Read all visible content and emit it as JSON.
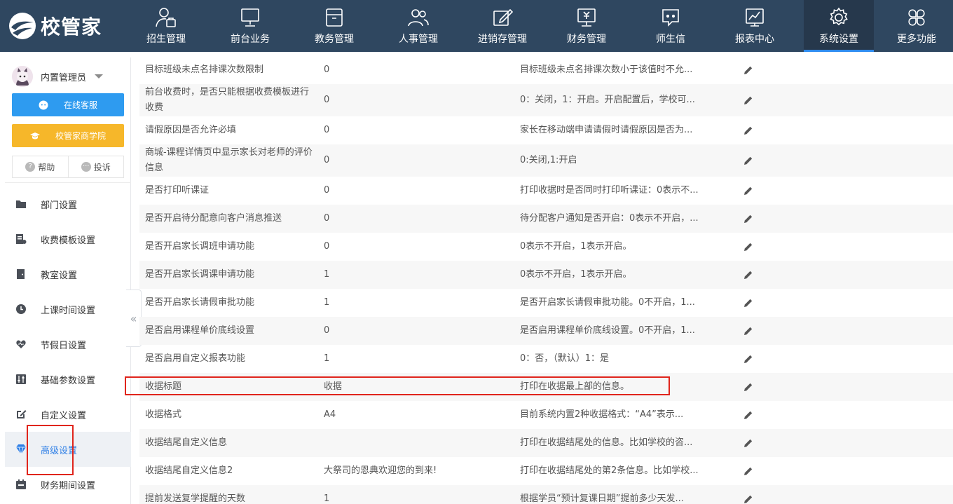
{
  "app": {
    "logo_text": "校管家"
  },
  "nav": [
    {
      "label": "招生管理",
      "icon": "user-case-icon"
    },
    {
      "label": "前台业务",
      "icon": "monitor-icon"
    },
    {
      "label": "教务管理",
      "icon": "archive-box-icon"
    },
    {
      "label": "人事管理",
      "icon": "users-icon"
    },
    {
      "label": "进销存管理",
      "icon": "edit-box-icon"
    },
    {
      "label": "财务管理",
      "icon": "finance-screen-icon"
    },
    {
      "label": "师生信",
      "icon": "chat-bubble-icon"
    },
    {
      "label": "报表中心",
      "icon": "report-chart-icon"
    },
    {
      "label": "系统设置",
      "icon": "gear-icon",
      "active": true
    },
    {
      "label": "更多功能",
      "icon": "grid-clover-icon"
    }
  ],
  "sidebar": {
    "user_name": "内置管理员",
    "service_button": "在线客服",
    "academy_button": "校管家商学院",
    "help_label": "帮助",
    "complain_label": "投诉",
    "items": [
      {
        "label": "部门设置",
        "icon": "folder-icon"
      },
      {
        "label": "收费模板设置",
        "icon": "fee-template-icon"
      },
      {
        "label": "教室设置",
        "icon": "door-icon"
      },
      {
        "label": "上课时间设置",
        "icon": "clock-icon"
      },
      {
        "label": "节假日设置",
        "icon": "heart-icon"
      },
      {
        "label": "基础参数设置",
        "icon": "sliders-icon"
      },
      {
        "label": "自定义设置",
        "icon": "pencil-box-icon"
      },
      {
        "label": "高级设置",
        "icon": "diamond-icon",
        "active": true
      },
      {
        "label": "财务期间设置",
        "icon": "calendar-icon"
      }
    ],
    "collapse_glyph": "«"
  },
  "settings": [
    {
      "name": "目标班级未点名排课次数限制",
      "value": "0",
      "desc": "目标班级未点名排课次数小于该值时不允..."
    },
    {
      "name": "前台收费时，是否只能根据收费模板进行收费",
      "value": "0",
      "desc": "0：关闭，1：开启。开启配置后，学校可..."
    },
    {
      "name": "请假原因是否允许必填",
      "value": "0",
      "desc": "家长在移动端申请请假时请假原因是否为..."
    },
    {
      "name": "商城-课程详情页中显示家长对老师的评价信息",
      "value": "0",
      "desc": "0:关闭,1:开启"
    },
    {
      "name": "是否打印听课证",
      "value": "0",
      "desc": "打印收据时是否同时打印听课证：0表示不..."
    },
    {
      "name": "是否开启待分配意向客户消息推送",
      "value": "0",
      "desc": "待分配客户通知是否开启：0表示不开启，..."
    },
    {
      "name": "是否开启家长调班申请功能",
      "value": "0",
      "desc": "0表示不开启，1表示开启。"
    },
    {
      "name": "是否开启家长调课申请功能",
      "value": "1",
      "desc": "0表示不开启，1表示开启。"
    },
    {
      "name": "是否开启家长请假审批功能",
      "value": "1",
      "desc": "是否开启家长请假审批功能。0不开启，1..."
    },
    {
      "name": "是否启用课程单价底线设置",
      "value": "0",
      "desc": "是否启用课程单价底线设置。0不开启，1..."
    },
    {
      "name": "是否启用自定义报表功能",
      "value": "1",
      "desc": "0：否，（默认）1：是"
    },
    {
      "name": "收据标题",
      "value": "收据",
      "desc": "打印在收据最上部的信息。"
    },
    {
      "name": "收据格式",
      "value": "A4",
      "desc": "目前系统内置2种收据格式：“A4”表示..."
    },
    {
      "name": "收据结尾自定义信息",
      "value": "",
      "desc": "打印在收据结尾处的信息。比如学校的咨..."
    },
    {
      "name": "收据结尾自定义信息2",
      "value": "大祭司的恩典欢迎您的到来!",
      "desc": "打印在收据结尾处的第2条信息。比如学校..."
    },
    {
      "name": "提前发送复学提醒的天数",
      "value": "1",
      "desc": "根据学员“预计复课日期”提前多少天发..."
    }
  ],
  "colors": {
    "nav_bg": "#2f4760",
    "accent": "#2e8cf0",
    "service_button": "#2e9bf0",
    "academy_button": "#f6b72a",
    "highlight": "#e0251c"
  }
}
